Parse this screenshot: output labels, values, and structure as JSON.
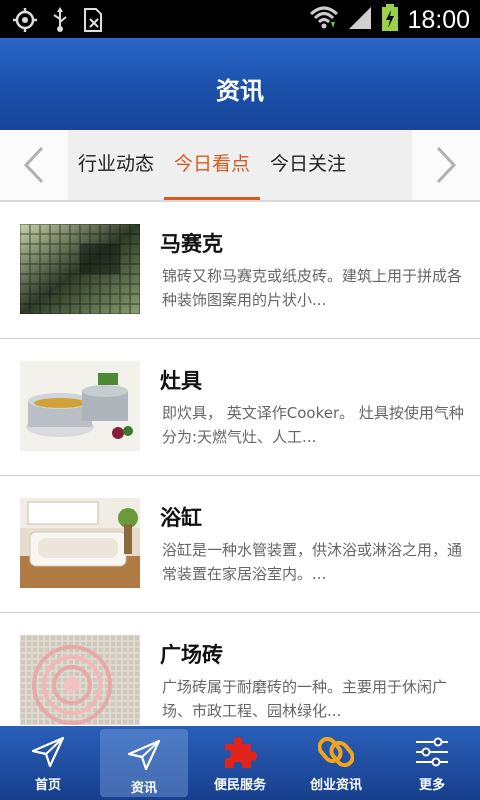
{
  "status_bar": {
    "time": "18:00"
  },
  "header": {
    "title": "资讯"
  },
  "tabs": [
    {
      "label": "行业动态",
      "active": false
    },
    {
      "label": "今日看点",
      "active": true
    },
    {
      "label": "今日关注",
      "active": false
    }
  ],
  "articles": [
    {
      "title": "马赛克",
      "desc": "锦砖又称马赛克或纸皮砖。建筑上用于拼成各种装饰图案用的片状小..."
    },
    {
      "title": "灶具",
      "desc": "即炊具，  英文译作Cooker。 灶具按使用气种分为:天燃气灶、人工..."
    },
    {
      "title": "浴缸",
      "desc": "浴缸是一种水管装置，供沐浴或淋浴之用，通常装置在家居浴室内。..."
    },
    {
      "title": "广场砖",
      "desc": "广场砖属于耐磨砖的一种。主要用于休闲广场、市政工程、园林绿化..."
    }
  ],
  "bottom_nav": [
    {
      "label": "首页",
      "icon": "paper-plane-icon",
      "active": false
    },
    {
      "label": "资讯",
      "icon": "paper-plane-icon",
      "active": true
    },
    {
      "label": "便民服务",
      "icon": "puzzle-icon",
      "active": false
    },
    {
      "label": "创业资讯",
      "icon": "chain-link-icon",
      "active": false
    },
    {
      "label": "更多",
      "icon": "sliders-icon",
      "active": false
    }
  ],
  "colors": {
    "accent": "#d75a1e",
    "header_blue": "#1a4fa8",
    "nav_blue": "#173f8c"
  }
}
